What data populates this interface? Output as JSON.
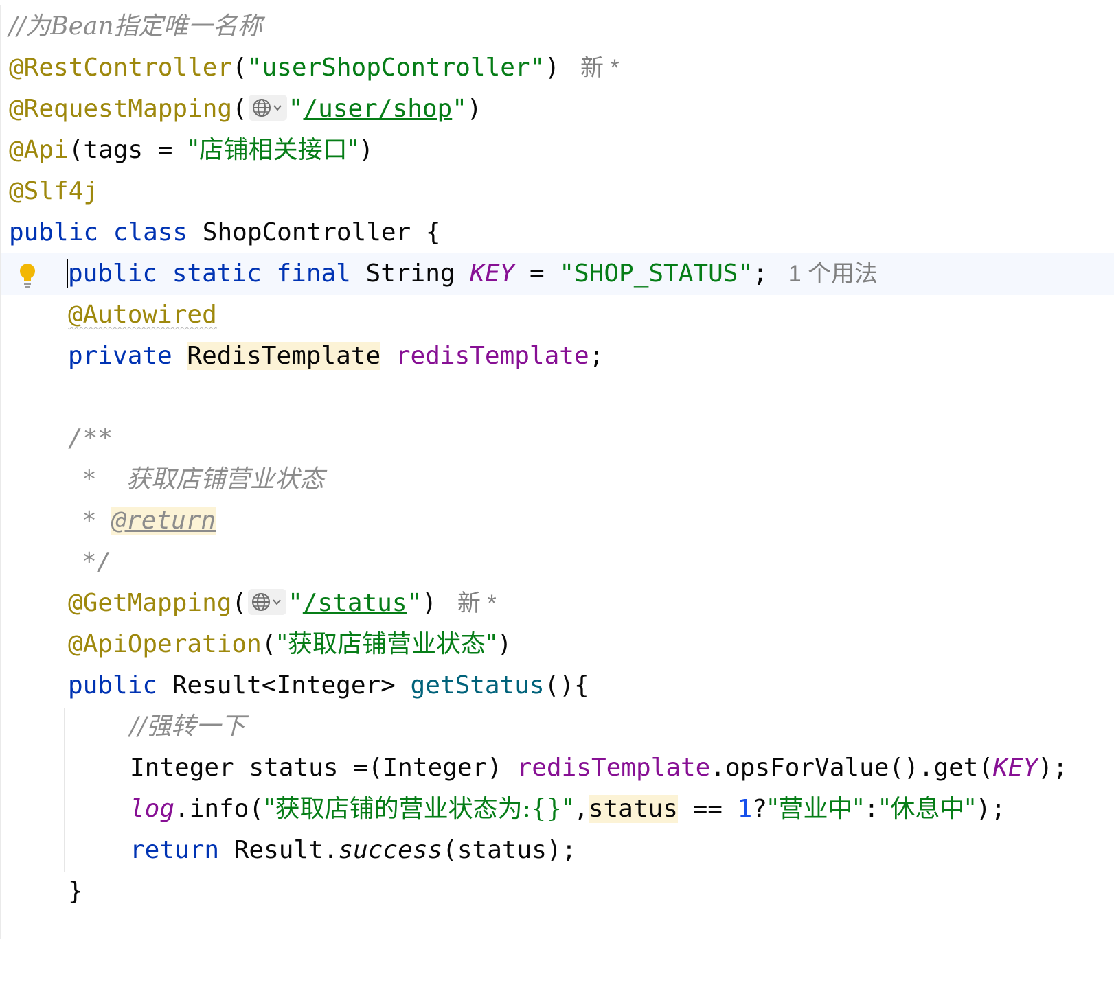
{
  "editor": {
    "comment_bean_name": "//为Bean指定唯一名称",
    "rest_controller_ann": "@RestController",
    "rest_controller_value": "\"userShopController\"",
    "new_marker": "新 *",
    "request_mapping_ann": "@RequestMapping",
    "request_mapping_path": "/user/shop",
    "api_ann": "@Api",
    "api_tags_key": "tags",
    "api_tags_value": "\"店铺相关接口\"",
    "slf4j_ann": "@Slf4j",
    "kw_public": "public",
    "kw_class": "class",
    "class_name": "ShopController",
    "kw_static": "static",
    "kw_final": "final",
    "type_string": "String",
    "const_key": "KEY",
    "const_value": "\"SHOP_STATUS\"",
    "usage_hint": "1 个用法",
    "autowired_ann": "@Autowired",
    "kw_private": "private",
    "type_redis": "RedisTemplate",
    "field_redis": "redisTemplate",
    "doc_open": "/**",
    "doc_star": "*",
    "doc_desc": "获取店铺营业状态",
    "doc_return": "@return",
    "doc_close": "*/",
    "get_mapping_ann": "@GetMapping",
    "get_mapping_path": "/status",
    "api_operation_ann": "@ApiOperation",
    "api_operation_value": "\"获取店铺营业状态\"",
    "result_type": "Result<Integer>",
    "method_name": "getStatus",
    "comment_cast": "//强转一下",
    "type_integer": "Integer",
    "var_status": "status",
    "cast_expr": "=(Integer)",
    "ops_call": ".opsForValue().get(",
    "log_field": "log",
    "log_info": ".info(",
    "log_msg": "\"获取店铺的营业状态为:{}\"",
    "eq_op": "==",
    "num_one": "1",
    "str_open": "\"营业中\"",
    "str_closed": "\"休息中\"",
    "kw_return": "return",
    "result_cls": "Result.",
    "success_call": "success",
    "return_arg": "(status);",
    "brace_close": "}"
  }
}
